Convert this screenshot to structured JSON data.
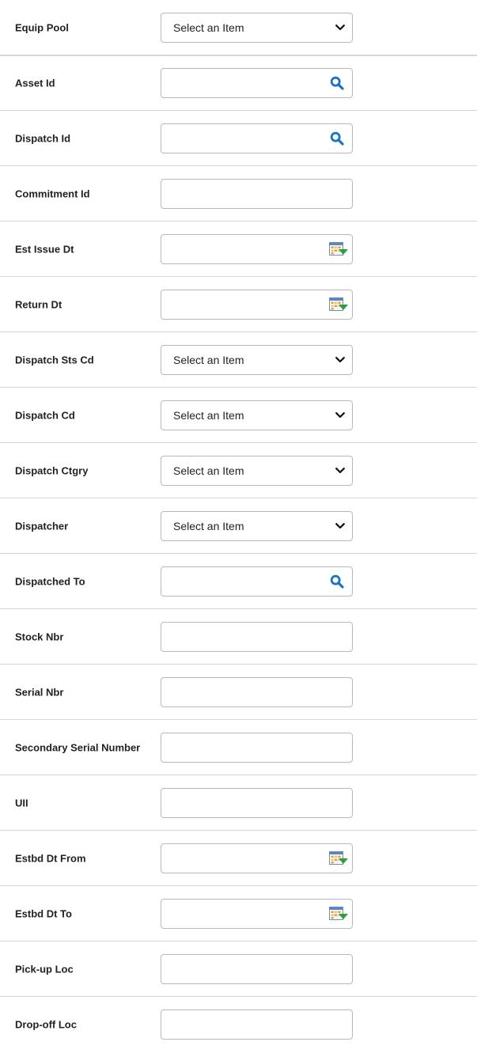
{
  "fields": {
    "equip_pool": {
      "label": "Equip Pool",
      "value": "Select an Item"
    },
    "asset_id": {
      "label": "Asset Id",
      "value": ""
    },
    "dispatch_id": {
      "label": "Dispatch Id",
      "value": ""
    },
    "commitment_id": {
      "label": "Commitment Id",
      "value": ""
    },
    "est_issue_dt": {
      "label": "Est Issue Dt",
      "value": ""
    },
    "return_dt": {
      "label": "Return Dt",
      "value": ""
    },
    "dispatch_sts_cd": {
      "label": "Dispatch Sts Cd",
      "value": "Select an Item"
    },
    "dispatch_cd": {
      "label": "Dispatch Cd",
      "value": "Select an Item"
    },
    "dispatch_ctgry": {
      "label": "Dispatch Ctgry",
      "value": "Select an Item"
    },
    "dispatcher": {
      "label": "Dispatcher",
      "value": "Select an Item"
    },
    "dispatched_to": {
      "label": "Dispatched To",
      "value": ""
    },
    "stock_nbr": {
      "label": "Stock Nbr",
      "value": ""
    },
    "serial_nbr": {
      "label": "Serial Nbr",
      "value": ""
    },
    "secondary_serial_number": {
      "label": "Secondary Serial Number",
      "value": ""
    },
    "uii": {
      "label": "UII",
      "value": ""
    },
    "estbd_dt_from": {
      "label": "Estbd Dt From",
      "value": ""
    },
    "estbd_dt_to": {
      "label": "Estbd Dt To",
      "value": ""
    },
    "pickup_loc": {
      "label": "Pick-up Loc",
      "value": ""
    },
    "dropoff_loc": {
      "label": "Drop-off Loc",
      "value": ""
    }
  },
  "colors": {
    "search_icon": "#1a73c6",
    "calendar_green": "#2e9e3e",
    "calendar_orange": "#e89a2c"
  },
  "icons": {
    "select": "chevron-down-icon",
    "lookup": "search-icon",
    "date": "calendar-icon"
  }
}
